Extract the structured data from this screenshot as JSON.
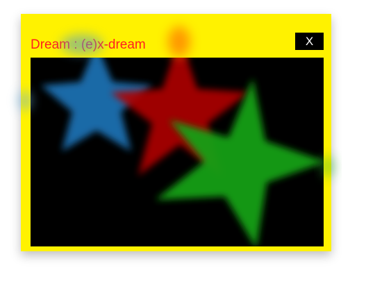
{
  "window": {
    "title": "Dream : (e)x-dream",
    "close_label": "X"
  },
  "colors": {
    "window_bg": "#fff200",
    "title_color": "#ff1f1f",
    "canvas_bg": "#000000",
    "star_blue": "#1f6fb0",
    "star_red": "#c00000",
    "star_green": "#1ea01e"
  },
  "canvas": {
    "icon_names": [
      "star-blue-icon",
      "star-red-icon",
      "star-green-icon"
    ]
  }
}
